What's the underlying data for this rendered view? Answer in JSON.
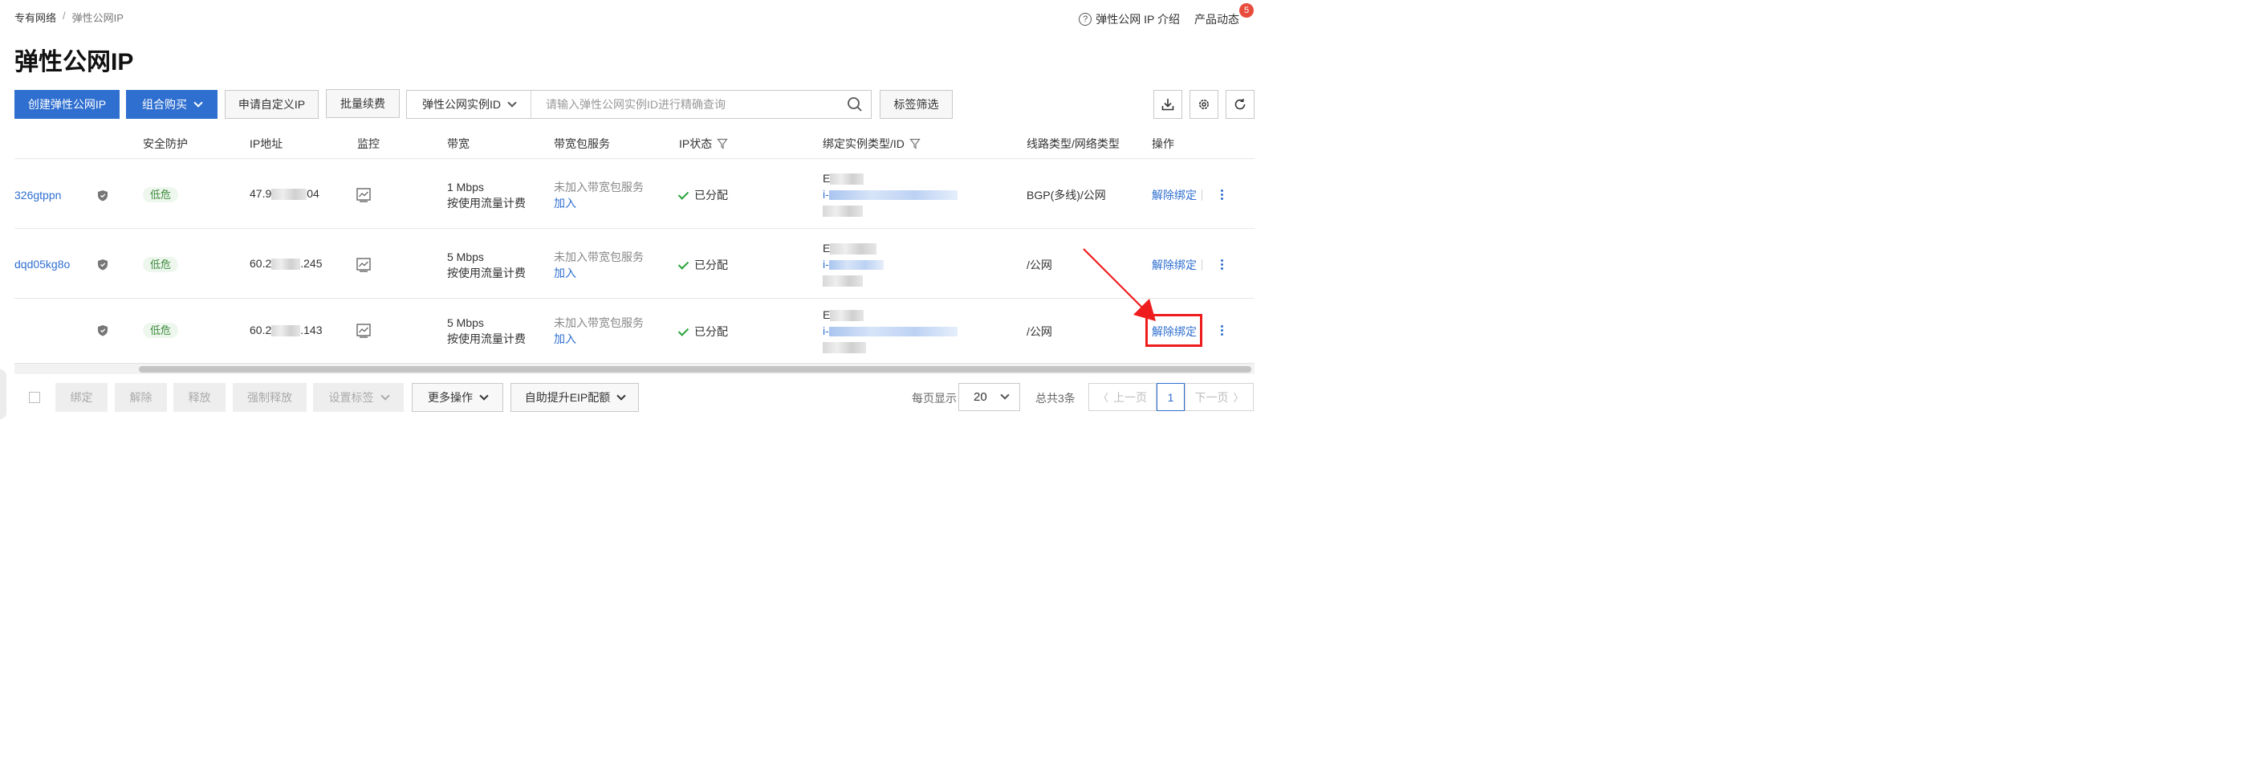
{
  "breadcrumb": {
    "parent": "专有网络",
    "separator": "/",
    "current": "弹性公网IP"
  },
  "top_links": {
    "help": "弹性公网 IP 介绍",
    "news": "产品动态",
    "news_badge": "5"
  },
  "page_title": "弹性公网IP",
  "toolbar": {
    "create_label": "创建弹性公网IP",
    "combo_label": "组合购买",
    "apply_custom_label": "申请自定义IP",
    "batch_renew_label": "批量续费",
    "search_field_selected": "弹性公网实例ID",
    "search_placeholder": "请输入弹性公网实例ID进行精确查询",
    "tag_filter_label": "标签筛选",
    "icons": [
      "download-icon",
      "settings-icon",
      "refresh-icon"
    ]
  },
  "table": {
    "columns": [
      "安全防护",
      "IP地址",
      "监控",
      "带宽",
      "带宽包服务",
      "IP状态",
      "绑定实例类型/ID",
      "线路类型/网络类型",
      "操作"
    ],
    "rows": [
      {
        "id_suffix": "326gtppn",
        "risk": "低危",
        "ip_prefix": "47.9",
        "ip_suffix": "04",
        "bandwidth": "1 Mbps",
        "billing": "按使用流量计费",
        "bwp_status": "未加入带宽包服务",
        "bwp_action": "加入",
        "status": "已分配",
        "instance_type": "E",
        "instance_id_prefix": "i-",
        "network": "BGP(多线)/公网",
        "action": "解除绑定"
      },
      {
        "id_suffix": "dqd05kg8o",
        "risk": "低危",
        "ip_prefix": "60.2",
        "ip_suffix": ".245",
        "bandwidth": "5 Mbps",
        "billing": "按使用流量计费",
        "bwp_status": "未加入带宽包服务",
        "bwp_action": "加入",
        "status": "已分配",
        "instance_type": "E",
        "instance_id_prefix": "i-",
        "network": "/公网",
        "action": "解除绑定"
      },
      {
        "id_suffix": "",
        "risk": "低危",
        "ip_prefix": "60.2",
        "ip_suffix": ".143",
        "bandwidth": "5 Mbps",
        "billing": "按使用流量计费",
        "bwp_status": "未加入带宽包服务",
        "bwp_action": "加入",
        "status": "已分配",
        "instance_type": "E",
        "instance_id_prefix": "i-",
        "network": "/公网",
        "action": "解除绑定"
      }
    ]
  },
  "footer": {
    "bind": "绑定",
    "unbind": "解除",
    "release": "释放",
    "force_release": "强制释放",
    "set_tags": "设置标签",
    "more_ops": "更多操作",
    "quota": "自助提升EIP配额",
    "per_page_label": "每页显示",
    "per_page_value": "20",
    "total": "总共3条",
    "prev": "上一页",
    "next": "下一页",
    "current_page": "1"
  },
  "colors": {
    "primary": "#2f6fd0",
    "annotation": "#ee1c1c",
    "status_ok": "#2aa33a"
  }
}
